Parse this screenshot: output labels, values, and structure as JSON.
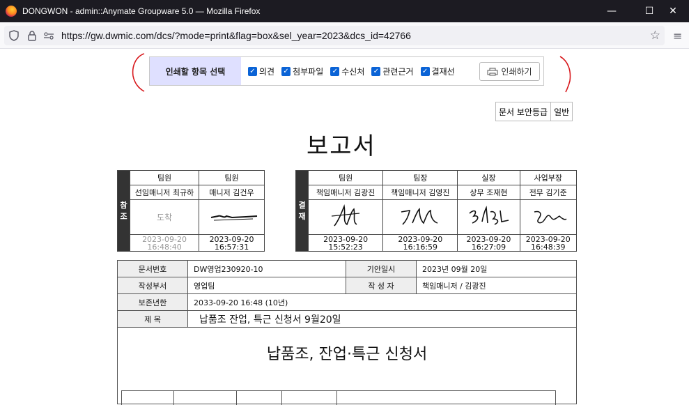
{
  "window": {
    "title": "DONGWON - admin::Anymate Groupware 5.0 — Mozilla Firefox",
    "minimize_label": "—",
    "maximize_label": "☐",
    "close_label": "✕"
  },
  "browser": {
    "url": "https://gw.dwmic.com/dcs/?mode=print&flag=box&sel_year=2023&dcs_id=42766"
  },
  "print_options": {
    "label": "인쇄할 항목 선택",
    "items": [
      {
        "label": "의견",
        "checked": true
      },
      {
        "label": "첨부파일",
        "checked": true
      },
      {
        "label": "수신처",
        "checked": true
      },
      {
        "label": "관련근거",
        "checked": true
      },
      {
        "label": "결재선",
        "checked": true
      }
    ],
    "print_button": "인쇄하기"
  },
  "security": {
    "label": "문서 보안등급",
    "value": "일반"
  },
  "doc_title": "보고서",
  "reference": {
    "side_label": "참조",
    "columns": [
      {
        "role": "팀원",
        "name": "선임매니저 최규하",
        "signature": "도착",
        "date": "2023-09-20",
        "time": "16:48:40",
        "dim": true
      },
      {
        "role": "팀원",
        "name": "매니저 김건우",
        "signature": "sig",
        "date": "2023-09-20",
        "time": "16:57:31",
        "dim": false
      }
    ]
  },
  "approval": {
    "side_label": "결재",
    "columns": [
      {
        "role": "팀원",
        "name": "책임매니저 김광진",
        "date": "2023-09-20",
        "time": "15:52:23"
      },
      {
        "role": "팀장",
        "name": "책임매니저 김영진",
        "date": "2023-09-20",
        "time": "16:16:59"
      },
      {
        "role": "실장",
        "name": "상무 조재현",
        "date": "2023-09-20",
        "time": "16:27:09"
      },
      {
        "role": "사업부장",
        "name": "전무 김기준",
        "date": "2023-09-20",
        "time": "16:48:39"
      }
    ]
  },
  "info": {
    "doc_no_label": "문서번호",
    "doc_no": "DW영업230920-10",
    "draft_date_label": "기안일시",
    "draft_date": "2023년 09월 20일",
    "dept_label": "작성부서",
    "dept": "영업팀",
    "author_label": "작 성 자",
    "author": "책임매니저 / 김광진",
    "retention_label": "보존년한",
    "retention": "2033-09-20 16:48 (10년)",
    "subject_label": "제 목",
    "subject": "납품조 잔업, 특근 신청서 9월20일"
  },
  "body": {
    "title": "납품조, 잔업·특근 신청서"
  }
}
